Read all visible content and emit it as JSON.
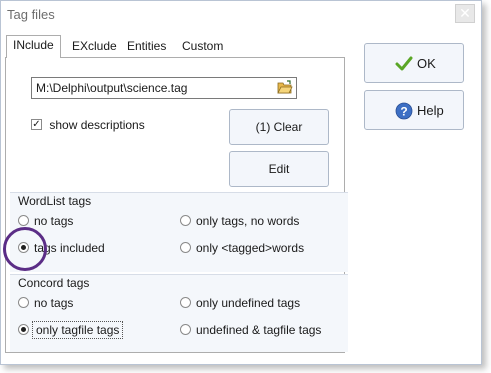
{
  "window": {
    "title": "Tag files",
    "close_glyph": "✕"
  },
  "tabs": [
    {
      "label": "INclude",
      "active": true
    },
    {
      "label": "EXclude",
      "active": false
    },
    {
      "label": "Entities",
      "active": false
    },
    {
      "label": "Custom",
      "active": false
    }
  ],
  "include": {
    "path_value": "M:\\Delphi\\output\\science.tag",
    "browse_icon": "folder-open-icon",
    "show_descriptions": {
      "label": "show descriptions",
      "checked": true,
      "check_glyph": "✓"
    },
    "clear_label": "(1) Clear",
    "edit_label": "Edit"
  },
  "wordlist_tags": {
    "title": "WordList tags",
    "options": [
      {
        "label": "no tags",
        "selected": false
      },
      {
        "label": "only tags, no words",
        "selected": false
      },
      {
        "label": "tags included",
        "selected": true
      },
      {
        "label": "only <tagged>words",
        "selected": false
      }
    ]
  },
  "concord_tags": {
    "title": "Concord tags",
    "options": [
      {
        "label": "no tags",
        "selected": false
      },
      {
        "label": "only undefined tags",
        "selected": false
      },
      {
        "label": "only tagfile tags",
        "selected": true
      },
      {
        "label": "undefined & tagfile tags",
        "selected": false
      }
    ]
  },
  "side_buttons": {
    "ok_label": "OK",
    "ok_icon": "green-check-icon",
    "help_label": "Help",
    "help_icon": "blue-question-icon"
  },
  "colors": {
    "group_bg": "#f4f7fb",
    "highlight_circle": "#5b2d86",
    "ok_check": "#5aa626",
    "help_blue": "#3d6fc4"
  }
}
